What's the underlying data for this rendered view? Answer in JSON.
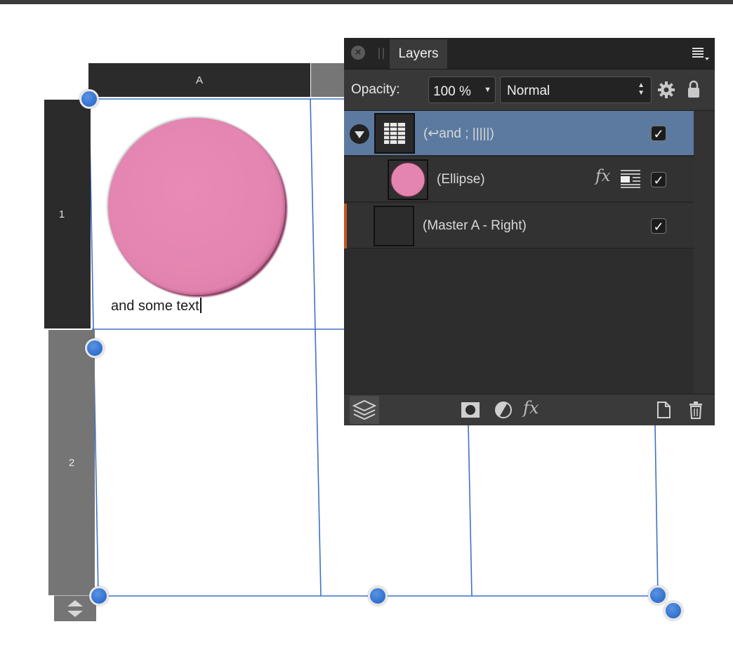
{
  "table": {
    "column_header": "A",
    "row_headers": [
      "1",
      "2"
    ],
    "cell_text": "and some text"
  },
  "layers_panel": {
    "tab_label": "Layers",
    "opacity_label": "Opacity:",
    "opacity_value": "100 %",
    "blend_mode": "Normal",
    "layers": [
      {
        "name": "(↩and ; |||||)",
        "selected": true,
        "visible": true
      },
      {
        "name": "(Ellipse)",
        "selected": false,
        "visible": true
      },
      {
        "name": "(Master A - Right)",
        "selected": false,
        "visible": true
      }
    ],
    "fx_label": "fx"
  },
  "colors": {
    "selection_accent": "#2f6fd0",
    "selected_layer_bg": "#5c7aa0",
    "ellipse_fill": "#e385b0"
  }
}
